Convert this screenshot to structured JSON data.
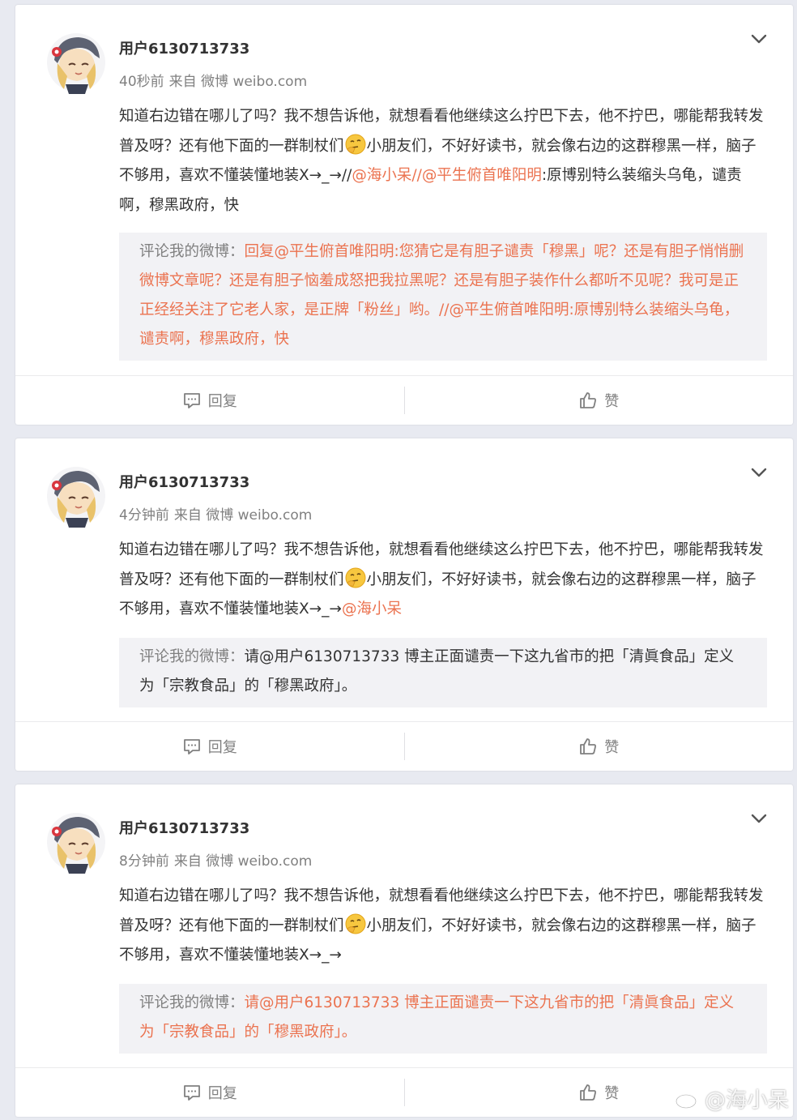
{
  "posts": [
    {
      "username": "用户6130713733",
      "time": "40秒前",
      "source": "来自 微博 weibo.com",
      "body": [
        "知道右边错在哪儿了吗？我不想告诉他，就想看看他继续这么拧巴下去，他不拧巴，哪能帮我转发普及呀？还有他下面的一群制杖们",
        "小朋友们，不好好读书，就会像右边的这群穆黑一样，脑子不够用，喜欢不懂装懂地装X→_→//",
        "@海小呆",
        "//",
        "@平生俯首唯阳明",
        ":原博别特么装缩头乌龟，谴责啊，穆黑政府，快"
      ],
      "quote_label": "评论我的微博：",
      "quote_text": "回复@平生俯首唯阳明:您猜它是有胆子谴责「穆黑」呢？还是有胆子悄悄删微博文章呢？还是有胆子恼羞成怒把我拉黑呢？还是有胆子装作什么都听不见呢？我可是正正经经关注了它老人家，是正牌「粉丝」哟。//@平生俯首唯阳明:原博别特么装缩头乌龟，谴责啊，穆黑政府，快"
    },
    {
      "username": "用户6130713733",
      "time": "4分钟前",
      "source": "来自 微博 weibo.com",
      "body": [
        "知道右边错在哪儿了吗？我不想告诉他，就想看看他继续这么拧巴下去，他不拧巴，哪能帮我转发普及呀？还有他下面的一群制杖们",
        "小朋友们，不好好读书，就会像右边的这群穆黑一样，脑子不够用，喜欢不懂装懂地装X→_→",
        "@海小呆"
      ],
      "quote_label": "评论我的微博：",
      "quote_text": "请@用户6130713733 博主正面谴责一下这九省市的把「清眞食品」定义为「宗教食品」的「穆黑政府」。"
    },
    {
      "username": "用户6130713733",
      "time": "8分钟前",
      "source": "来自 微博 weibo.com",
      "body": [
        "知道右边错在哪儿了吗？我不想告诉他，就想看看他继续这么拧巴下去，他不拧巴，哪能帮我转发普及呀？还有他下面的一群制杖们",
        "小朋友们，不好好读书，就会像右边的这群穆黑一样，脑子不够用，喜欢不懂装懂地装X→_→"
      ],
      "quote_label": "评论我的微博：",
      "quote_text": "请@用户6130713733 博主正面谴责一下这九省市的把「清眞食品」定义为「宗教食品」的「穆黑政府」。"
    }
  ],
  "actions": {
    "reply_label": "回复",
    "like_label": "赞"
  },
  "watermark": "@海小呆",
  "colors": {
    "background": "#e8eaf1",
    "link": "#eb7350",
    "meta": "#808080",
    "quote_bg": "#f2f2f5"
  },
  "icons": [
    "avatar-anime-girl",
    "chevron-down-icon",
    "emoji-thinking-icon",
    "comment-icon",
    "thumbs-up-icon",
    "weibo-logo-icon"
  ]
}
